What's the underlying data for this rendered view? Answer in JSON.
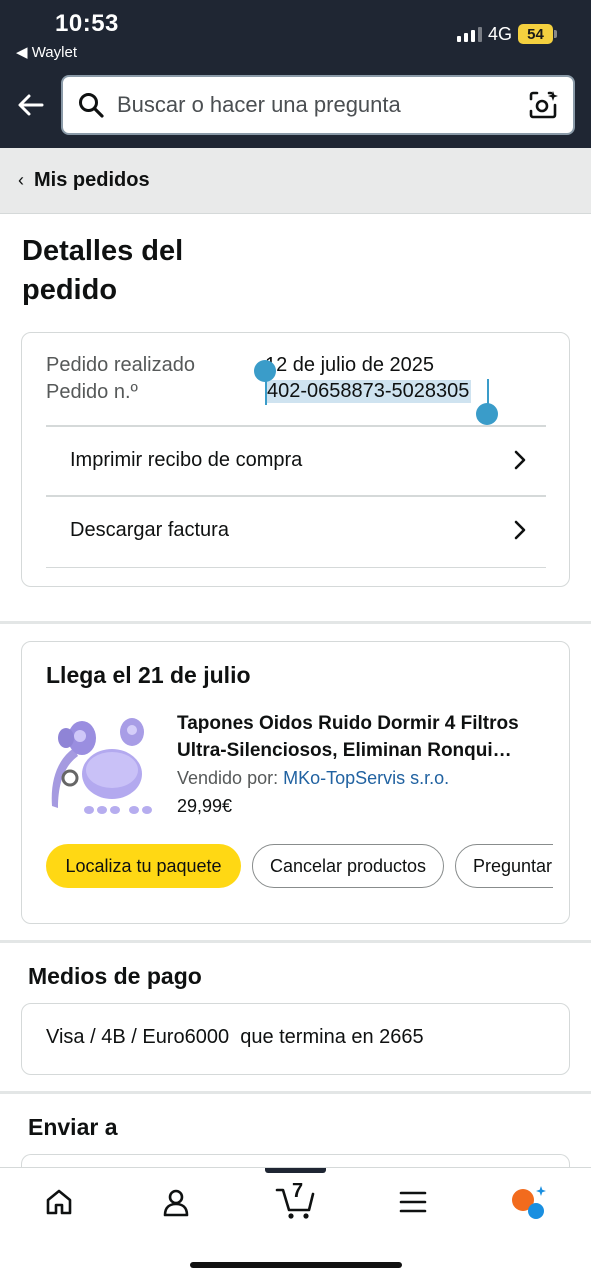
{
  "status_bar": {
    "time": "10:53",
    "back_app": "◀ Waylet",
    "network": "4G",
    "battery": "54"
  },
  "search": {
    "placeholder": "Buscar o hacer una pregunta"
  },
  "breadcrumb": {
    "label": "Mis pedidos"
  },
  "page": {
    "title": "Detalles del pedido"
  },
  "order": {
    "placed_label": "Pedido realizado",
    "placed_value": "12 de julio de 2025",
    "number_label": "Pedido n.º",
    "number_value": "402-0658873-5028305",
    "actions": [
      {
        "label": "Imprimir recibo de compra"
      },
      {
        "label": "Descargar factura"
      }
    ]
  },
  "delivery": {
    "title": "Llega el 21 de julio",
    "product": {
      "title": "Tapones Oidos Ruido Dormir 4 Filtros Ultra-Silenciosos, Eliminan Ronqui…",
      "seller_prefix": "Vendido por:",
      "seller_name": "MKo-TopServis s.r.o.",
      "price": "29,99€"
    },
    "buttons": [
      {
        "label": "Localiza tu paquete"
      },
      {
        "label": "Cancelar productos"
      },
      {
        "label": "Preguntar"
      }
    ]
  },
  "payment": {
    "heading": "Medios de pago",
    "method": "Visa / 4B / Euro6000  que termina en 2665"
  },
  "shipping": {
    "heading": "Enviar a"
  },
  "bottom_nav": {
    "items": [
      "home-icon",
      "account-icon",
      "cart-icon",
      "menu-icon",
      "rufus-icon"
    ],
    "cart_count": "7"
  },
  "colors": {
    "header_bg": "#1f2633",
    "accent_yellow": "#ffd814",
    "link_blue": "#2162a1",
    "selection": "#3a9cc9"
  }
}
